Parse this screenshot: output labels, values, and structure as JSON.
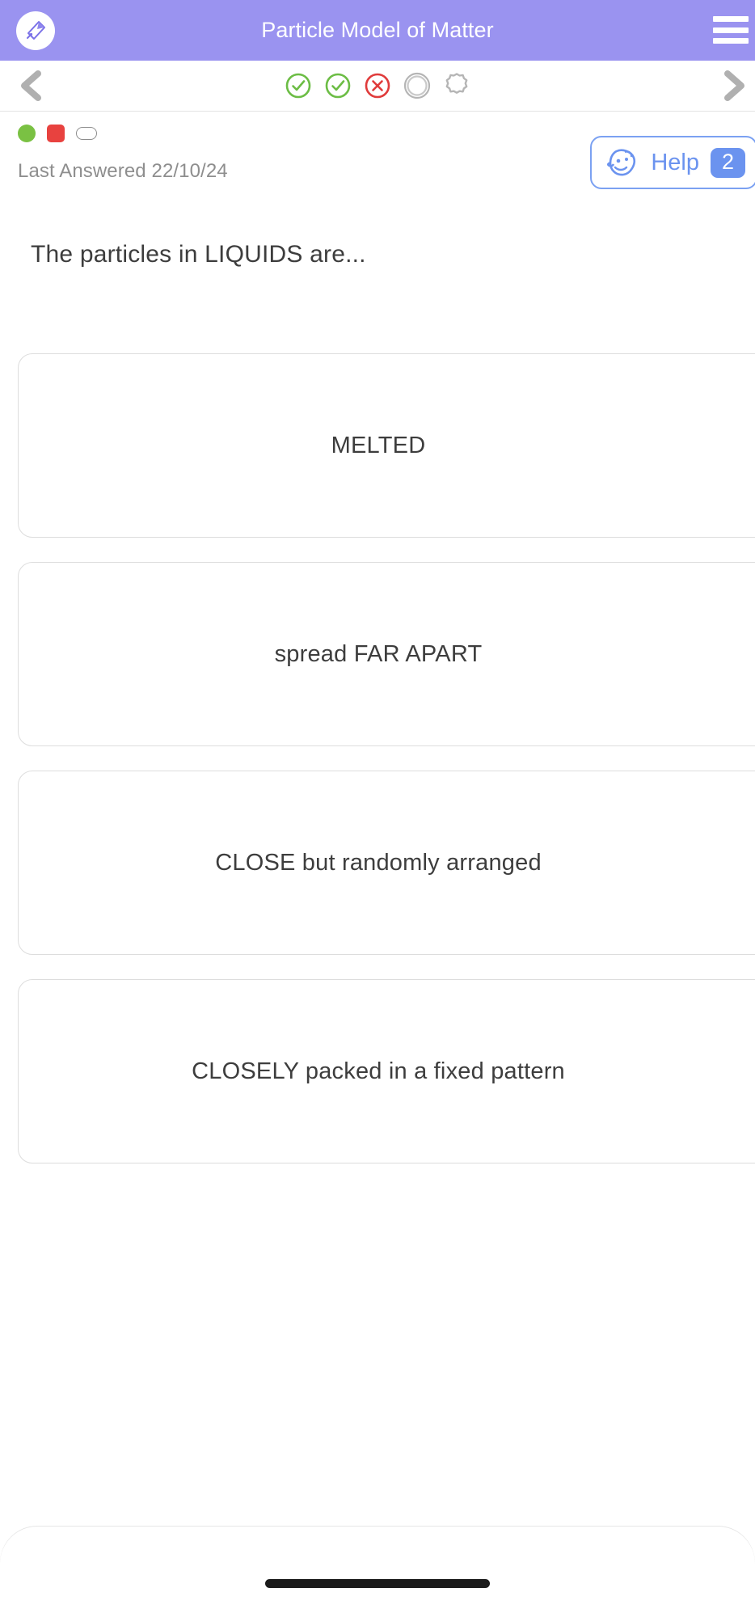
{
  "appbar": {
    "title": "Particle Model of Matter",
    "logo_icon": "quiz-gem-logo-icon",
    "menu_icon": "hamburger-menu-icon"
  },
  "navstrip": {
    "prev_icon": "chevron-left-icon",
    "next_icon": "chevron-right-icon",
    "steps": [
      {
        "name": "step-1",
        "state": "correct",
        "icon": "check-circle-icon",
        "color": "#6cbd45"
      },
      {
        "name": "step-2",
        "state": "correct",
        "icon": "check-circle-icon",
        "color": "#6cbd45"
      },
      {
        "name": "step-3",
        "state": "incorrect",
        "icon": "cross-circle-icon",
        "color": "#e03b3b"
      },
      {
        "name": "step-4",
        "state": "current",
        "icon": "ring-circle-icon",
        "color": "#b5b5b5"
      },
      {
        "name": "step-5",
        "state": "upcoming",
        "icon": "gear-circle-icon",
        "color": "#b5b5b5"
      }
    ]
  },
  "status": {
    "dots": [
      {
        "name": "status-dot-correct",
        "color": "#7ac143"
      },
      {
        "name": "status-dot-incorrect",
        "color": "#e8423f"
      },
      {
        "name": "status-dot-unanswered",
        "color": "#8d8d8d"
      }
    ],
    "last_answered": "Last Answered 22/10/24",
    "help": {
      "label": "Help",
      "badge": "2",
      "icon": "help-dog-face-icon",
      "accent": "#6b93ef"
    }
  },
  "question": {
    "text": "The particles in LIQUIDS are..."
  },
  "options": [
    {
      "id": "option-melted",
      "text": "MELTED"
    },
    {
      "id": "option-spread-far-apart",
      "text": "spread FAR APART"
    },
    {
      "id": "option-close-randomly-arranged",
      "text": "CLOSE but randomly arranged"
    },
    {
      "id": "option-closely-packed-fixed-pattern",
      "text": "CLOSELY packed in a fixed pattern"
    }
  ],
  "bottom": {
    "home_indicator": "home-indicator"
  }
}
